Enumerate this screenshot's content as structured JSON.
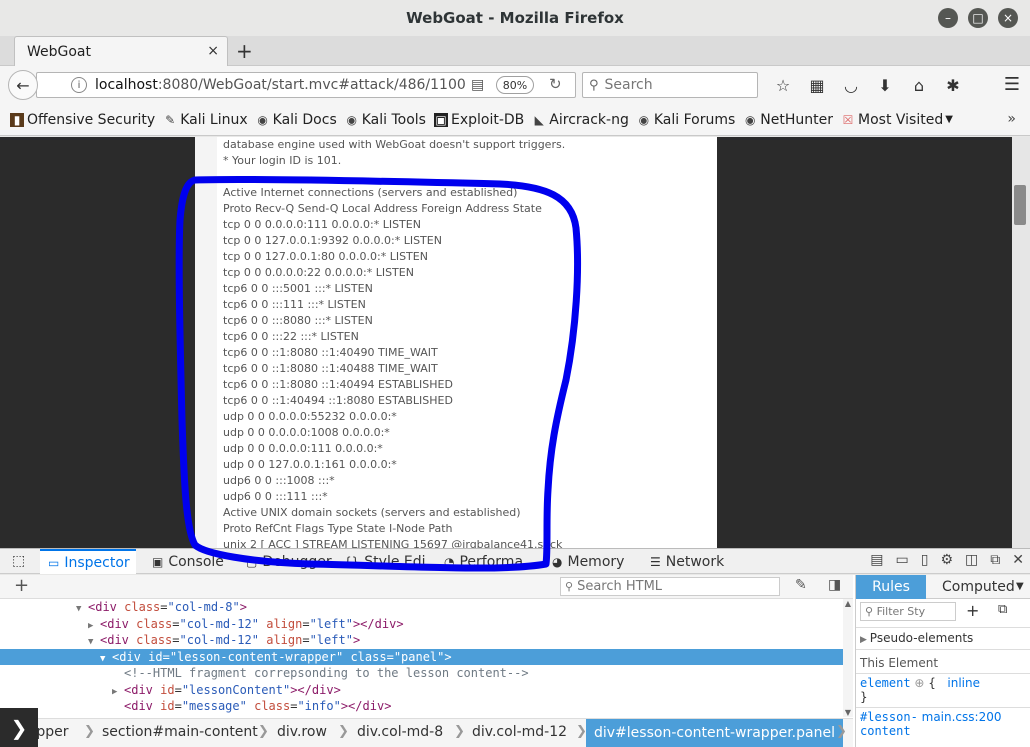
{
  "window": {
    "title": "WebGoat - Mozilla Firefox",
    "minimize": "–",
    "maximize": "□",
    "close": "×"
  },
  "tab": {
    "title": "WebGoat",
    "close": "×",
    "new": "+"
  },
  "navbar": {
    "url_host": "localhost",
    "url_rest": ":8080/WebGoat/start.mvc#attack/486/1100",
    "zoom": "80%",
    "search_placeholder": "Search"
  },
  "bookmarks": [
    {
      "label": "Offensive Security",
      "icon": "offsec-icon"
    },
    {
      "label": "Kali Linux",
      "icon": "kali-icon"
    },
    {
      "label": "Kali Docs",
      "icon": "globe-icon"
    },
    {
      "label": "Kali Tools",
      "icon": "globe-icon"
    },
    {
      "label": "Exploit-DB",
      "icon": "exploitdb-icon"
    },
    {
      "label": "Aircrack-ng",
      "icon": "aircrack-icon"
    },
    {
      "label": "Kali Forums",
      "icon": "globe-icon"
    },
    {
      "label": "NetHunter",
      "icon": "globe-icon"
    },
    {
      "label": "Most Visited",
      "icon": "star-folder-icon"
    }
  ],
  "page": {
    "lines": [
      "database engine used with WebGoat doesn't support triggers.",
      "* Your login ID is 101.",
      "",
      "Active Internet connections (servers and established)",
      "Proto Recv-Q Send-Q Local Address Foreign Address State",
      "tcp 0 0 0.0.0.0:111 0.0.0.0:* LISTEN",
      "tcp 0 0 127.0.0.1:9392 0.0.0.0:* LISTEN",
      "tcp 0 0 127.0.0.1:80 0.0.0.0:* LISTEN",
      "tcp 0 0 0.0.0.0:22 0.0.0.0:* LISTEN",
      "tcp6 0 0 :::5001 :::* LISTEN",
      "tcp6 0 0 :::111 :::* LISTEN",
      "tcp6 0 0 :::8080 :::* LISTEN",
      "tcp6 0 0 :::22 :::* LISTEN",
      "tcp6 0 0 ::1:8080 ::1:40490 TIME_WAIT",
      "tcp6 0 0 ::1:8080 ::1:40488 TIME_WAIT",
      "tcp6 0 0 ::1:8080 ::1:40494 ESTABLISHED",
      "tcp6 0 0 ::1:40494 ::1:8080 ESTABLISHED",
      "udp 0 0 0.0.0.0:55232 0.0.0.0:*",
      "udp 0 0 0.0.0.0:1008 0.0.0.0:*",
      "udp 0 0 0.0.0.0:111 0.0.0.0:*",
      "udp 0 0 127.0.0.1:161 0.0.0.0:*",
      "udp6 0 0 :::1008 :::*",
      "udp6 0 0 :::111 :::*",
      "Active UNIX domain sockets (servers and established)",
      "Proto RefCnt Flags Type State I-Node Path",
      "unix 2 [ ACC ] STREAM LISTENING 15697 @irqbalance41.sock"
    ]
  },
  "devtools": {
    "tabs": {
      "inspector": "Inspector",
      "console": "Console",
      "debugger": "Debugger",
      "style_editor": "Style Edi…",
      "performance": "Performa…",
      "memory": "Memory",
      "network": "Network"
    },
    "search_html": "Search HTML",
    "dom": {
      "l1_tag": "<div",
      "l1_attr": "class",
      "l1_val": "\"col-md-8\"",
      "l1_end": ">",
      "l2_tag": "<div",
      "l2_attr1": "class",
      "l2_val1": "\"col-md-12\"",
      "l2_attr2": "align",
      "l2_val2": "\"left\"",
      "l2_mid": "></",
      "l2_close": "div",
      "l2_end": ">",
      "l3_tag": "<div",
      "l3_attr1": "class",
      "l3_val1": "\"col-md-12\"",
      "l3_attr2": "align",
      "l3_val2": "\"left\"",
      "l3_end": ">",
      "l4_tag": "<div",
      "l4_attr1": "id",
      "l4_val1": "\"lesson-content-wrapper\"",
      "l4_attr2": "class",
      "l4_val2": "\"panel\"",
      "l4_end": ">",
      "l5_comment": "<!--HTML fragment correpsonding to the lesson content-->",
      "l6_tag": "<div",
      "l6_attr": "id",
      "l6_val": "\"lessonContent\"",
      "l6_mid": "></",
      "l6_close": "div",
      "l6_end": ">",
      "l7_tag": "<div",
      "l7_attr1": "id",
      "l7_val1": "\"message\"",
      "l7_attr2": "class",
      "l7_val2": "\"info\"",
      "l7_mid": "></",
      "l7_close": "div",
      "l7_end": ">"
    },
    "breadcrumbs": {
      "c1": "rapper",
      "c2": "section#main-content",
      "c3": "div.row",
      "c4": "div.col-md-8",
      "c5": "div.col-md-12",
      "c6": "div#lesson-content-wrapper.panel"
    },
    "rules": {
      "tab_rules": "Rules",
      "tab_computed": "Computed",
      "filter": "Filter Sty",
      "pseudo": "Pseudo-elements",
      "this_element": "This Element",
      "element": "element",
      "brace_open": "{",
      "inline": "inline",
      "brace_close": "}",
      "sel": "#lesson-",
      "sel2": "content",
      "file": "main.css:200"
    }
  },
  "colors": {
    "accent": "#0074e8",
    "selection": "#4c9ed9",
    "annotation": "#0000ee",
    "page_dark": "#2b2b2b"
  }
}
